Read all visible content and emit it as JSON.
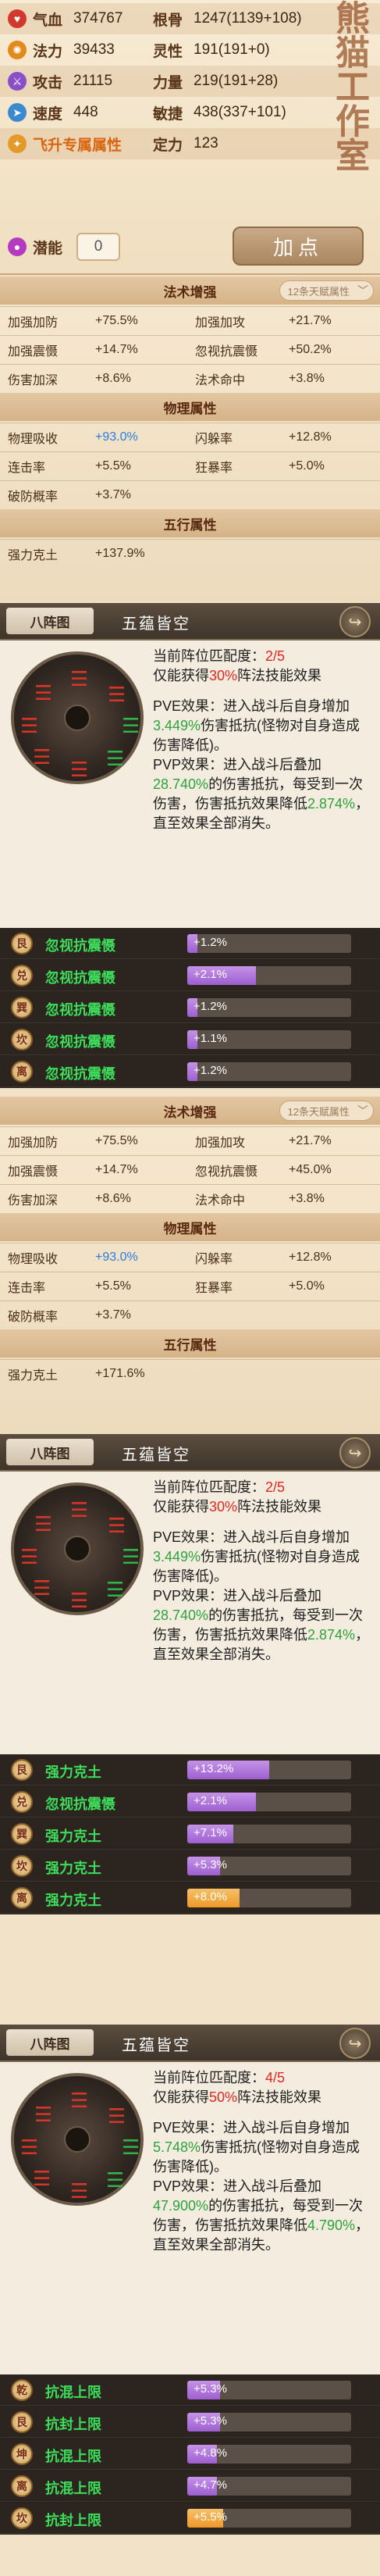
{
  "stats": {
    "rows": [
      {
        "l_icon": "blood-icon",
        "l_label": "气血",
        "l_value": "374767",
        "r_label": "根骨",
        "r_value": "1247(1139+108)"
      },
      {
        "l_icon": "magic-icon",
        "l_label": "法力",
        "l_value": "39433",
        "r_label": "灵性",
        "r_value": "191(191+0)"
      },
      {
        "l_icon": "sword-icon",
        "l_label": "攻击",
        "l_value": "21115",
        "r_label": "力量",
        "r_value": "219(191+28)"
      },
      {
        "l_icon": "boot-icon",
        "l_label": "速度",
        "l_value": "448",
        "r_label": "敏捷",
        "r_value": "438(337+101)"
      }
    ],
    "fly_label": "飞升专属属性",
    "fixed_label": "定力",
    "fixed_value": "123",
    "potential_label": "潜能",
    "potential_value": "0",
    "add_point_label": "加点"
  },
  "panels": [
    {
      "magic_title": "法术增强",
      "magic_pill": "12条天赋属性",
      "magic_rows": [
        [
          "加强加防",
          "+75.5%",
          "加强加攻",
          "+21.7%"
        ],
        [
          "加强震慑",
          "+14.7%",
          "忽视抗震慑",
          "+50.2%"
        ],
        [
          "伤害加深",
          "+8.6%",
          "法术命中",
          "+3.8%"
        ]
      ],
      "phys_title": "物理属性",
      "phys_rows": [
        [
          "物理吸收",
          "+93.0%",
          "闪躲率",
          "+12.8%"
        ],
        [
          "连击率",
          "+5.5%",
          "狂暴率",
          "+5.0%"
        ],
        [
          "破防概率",
          "+3.7%",
          "",
          ""
        ]
      ],
      "five_title": "五行属性",
      "five_rows": [
        [
          "强力克土",
          "+137.9%",
          "",
          ""
        ]
      ]
    },
    {
      "magic_title": "法术增强",
      "magic_pill": "12条天赋属性",
      "magic_rows": [
        [
          "加强加防",
          "+75.5%",
          "加强加攻",
          "+21.7%"
        ],
        [
          "加强震慑",
          "+14.7%",
          "忽视抗震慑",
          "+45.0%"
        ],
        [
          "伤害加深",
          "+8.6%",
          "法术命中",
          "+3.8%"
        ]
      ],
      "phys_title": "物理属性",
      "phys_rows": [
        [
          "物理吸收",
          "+93.0%",
          "闪躲率",
          "+12.8%"
        ],
        [
          "连击率",
          "+5.5%",
          "狂暴率",
          "+5.0%"
        ],
        [
          "破防概率",
          "+3.7%",
          "",
          ""
        ]
      ],
      "five_title": "五行属性",
      "five_rows": [
        [
          "强力克土",
          "+171.6%",
          "",
          ""
        ]
      ]
    }
  ],
  "formations": [
    {
      "tab": "八阵图",
      "title": "五蕴皆空",
      "match_prefix": "当前阵位匹配度：",
      "match_value": "2/5",
      "gain_prefix": "仅能获得",
      "gain_value": "30%",
      "gain_suffix": "阵法技能效果",
      "pve_a": "PVE效果：进入战斗后自身增加",
      "pve_val": "3.449%",
      "pve_b": "伤害抵抗(怪物对自身造成伤害降低)。",
      "pvp_a": "PVP效果：进入战斗后叠加",
      "pvp_val": "28.740%",
      "pvp_b": "的伤害抵抗，每受到一次伤害，伤害抵抗效果降低",
      "pvp_val2": "2.874%",
      "pvp_c": "，直至效果全部消失。",
      "bonuses": [
        {
          "icon": "艮",
          "name": "忽视抗震慑",
          "value": "+1.2%",
          "fill": 0.06,
          "color": "purple"
        },
        {
          "icon": "兑",
          "name": "忽视抗震慑",
          "value": "+2.1%",
          "fill": 0.42,
          "color": "purple"
        },
        {
          "icon": "巽",
          "name": "忽视抗震慑",
          "value": "+1.2%",
          "fill": 0.06,
          "color": "purple"
        },
        {
          "icon": "坎",
          "name": "忽视抗震慑",
          "value": "+1.1%",
          "fill": 0.06,
          "color": "purple"
        },
        {
          "icon": "离",
          "name": "忽视抗震慑",
          "value": "+1.2%",
          "fill": 0.06,
          "color": "purple"
        }
      ]
    },
    {
      "tab": "八阵图",
      "title": "五蕴皆空",
      "match_prefix": "当前阵位匹配度：",
      "match_value": "2/5",
      "gain_prefix": "仅能获得",
      "gain_value": "30%",
      "gain_suffix": "阵法技能效果",
      "pve_a": "PVE效果：进入战斗后自身增加",
      "pve_val": "3.449%",
      "pve_b": "伤害抵抗(怪物对自身造成伤害降低)。",
      "pvp_a": "PVP效果：进入战斗后叠加",
      "pvp_val": "28.740%",
      "pvp_b": "的伤害抵抗，每受到一次伤害，伤害抵抗效果降低",
      "pvp_val2": "2.874%",
      "pvp_c": "，直至效果全部消失。",
      "bonuses": [
        {
          "icon": "艮",
          "name": "强力克土",
          "value": "+13.2%",
          "fill": 0.5,
          "color": "purple"
        },
        {
          "icon": "兑",
          "name": "忽视抗震慑",
          "value": "+2.1%",
          "fill": 0.42,
          "color": "purple"
        },
        {
          "icon": "巽",
          "name": "强力克土",
          "value": "+7.1%",
          "fill": 0.28,
          "color": "purple"
        },
        {
          "icon": "坎",
          "name": "强力克土",
          "value": "+5.3%",
          "fill": 0.2,
          "color": "purple"
        },
        {
          "icon": "离",
          "name": "强力克土",
          "value": "+8.0%",
          "fill": 0.32,
          "color": "orange"
        }
      ]
    },
    {
      "tab": "八阵图",
      "title": "五蕴皆空",
      "match_prefix": "当前阵位匹配度：",
      "match_value": "4/5",
      "gain_prefix": "仅能获得",
      "gain_value": "50%",
      "gain_suffix": "阵法技能效果",
      "pve_a": "PVE效果：进入战斗后自身增加",
      "pve_val": "5.748%",
      "pve_b": "伤害抵抗(怪物对自身造成伤害降低)。",
      "pvp_a": "PVP效果：进入战斗后叠加",
      "pvp_val": "47.900%",
      "pvp_b": "的伤害抵抗，每受到一次伤害，伤害抵抗效果降低",
      "pvp_val2": "4.790%",
      "pvp_c": "，直至效果全部消失。",
      "bonuses": [
        {
          "icon": "乾",
          "name": "抗混上限",
          "value": "+5.3%",
          "fill": 0.2,
          "color": "purple"
        },
        {
          "icon": "艮",
          "name": "抗封上限",
          "value": "+5.3%",
          "fill": 0.2,
          "color": "purple"
        },
        {
          "icon": "坤",
          "name": "抗混上限",
          "value": "+4.8%",
          "fill": 0.18,
          "color": "purple"
        },
        {
          "icon": "离",
          "name": "抗混上限",
          "value": "+4.7%",
          "fill": 0.18,
          "color": "purple"
        },
        {
          "icon": "坎",
          "name": "抗封上限",
          "value": "+5.5%",
          "fill": 0.22,
          "color": "orange"
        }
      ]
    }
  ],
  "watermark": "熊猫工作室"
}
